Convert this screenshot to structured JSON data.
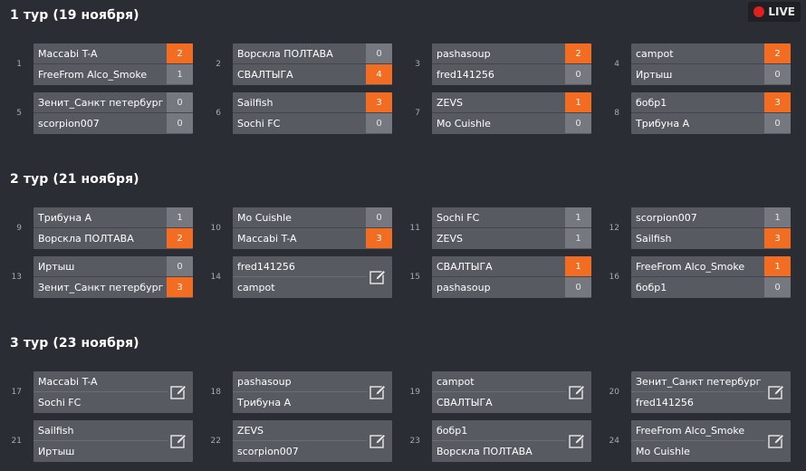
{
  "live": {
    "label": "LIVE"
  },
  "colors": {
    "background": "#2b2d35",
    "card": "#585a62",
    "score": "#767880",
    "win": "#f26d21",
    "live_dot": "#e0201c"
  },
  "rounds": [
    {
      "title": "1 тур (19 ноября)",
      "matches": [
        {
          "num": "1",
          "home": "Maccabi T-A",
          "away": "FreeFrom Alco_Smoke",
          "home_score": "2",
          "away_score": "1",
          "winner": "home"
        },
        {
          "num": "2",
          "home": "Ворскла ПОЛТАВА",
          "away": "СВАЛТЫГА",
          "home_score": "0",
          "away_score": "4",
          "winner": "away"
        },
        {
          "num": "3",
          "home": "pashasoup",
          "away": "fred141256",
          "home_score": "2",
          "away_score": "0",
          "winner": "home"
        },
        {
          "num": "4",
          "home": "campot",
          "away": "Иртыш",
          "home_score": "2",
          "away_score": "0",
          "winner": "home"
        },
        {
          "num": "5",
          "home": "Зенит_Санкт петербург",
          "away": "scorpion007",
          "home_score": "0",
          "away_score": "0",
          "winner": ""
        },
        {
          "num": "6",
          "home": "Sailfish",
          "away": "Sochi FC",
          "home_score": "3",
          "away_score": "0",
          "winner": "home"
        },
        {
          "num": "7",
          "home": "ZEVS",
          "away": "Mo Cuishle",
          "home_score": "1",
          "away_score": "0",
          "winner": "home"
        },
        {
          "num": "8",
          "home": "бобр1",
          "away": "Трибуна А",
          "home_score": "3",
          "away_score": "0",
          "winner": "home"
        }
      ]
    },
    {
      "title": "2 тур (21 ноября)",
      "matches": [
        {
          "num": "9",
          "home": "Трибуна А",
          "away": "Ворскла ПОЛТАВА",
          "home_score": "1",
          "away_score": "2",
          "winner": "away"
        },
        {
          "num": "10",
          "home": "Mo Cuishle",
          "away": "Maccabi T-A",
          "home_score": "0",
          "away_score": "3",
          "winner": "away"
        },
        {
          "num": "11",
          "home": "Sochi FC",
          "away": "ZEVS",
          "home_score": "1",
          "away_score": "1",
          "winner": ""
        },
        {
          "num": "12",
          "home": "scorpion007",
          "away": "Sailfish",
          "home_score": "1",
          "away_score": "3",
          "winner": "away"
        },
        {
          "num": "13",
          "home": "Иртыш",
          "away": "Зенит_Санкт петербург",
          "home_score": "0",
          "away_score": "3",
          "winner": "away"
        },
        {
          "num": "14",
          "home": "fred141256",
          "away": "campot",
          "home_score": "",
          "away_score": "",
          "winner": "",
          "pending": true
        },
        {
          "num": "15",
          "home": "СВАЛТЫГА",
          "away": "pashasoup",
          "home_score": "1",
          "away_score": "0",
          "winner": "home"
        },
        {
          "num": "16",
          "home": "FreeFrom Alco_Smoke",
          "away": "бобр1",
          "home_score": "1",
          "away_score": "0",
          "winner": "home"
        }
      ]
    },
    {
      "title": "3 тур (23 ноября)",
      "matches": [
        {
          "num": "17",
          "home": "Maccabi T-A",
          "away": "Sochi FC",
          "home_score": "",
          "away_score": "",
          "winner": "",
          "pending": true
        },
        {
          "num": "18",
          "home": "pashasoup",
          "away": "Трибуна А",
          "home_score": "",
          "away_score": "",
          "winner": "",
          "pending": true
        },
        {
          "num": "19",
          "home": "campot",
          "away": "СВАЛТЫГА",
          "home_score": "",
          "away_score": "",
          "winner": "",
          "pending": true
        },
        {
          "num": "20",
          "home": "Зенит_Санкт петербург",
          "away": "fred141256",
          "home_score": "",
          "away_score": "",
          "winner": "",
          "pending": true
        },
        {
          "num": "21",
          "home": "Sailfish",
          "away": "Иртыш",
          "home_score": "",
          "away_score": "",
          "winner": "",
          "pending": true
        },
        {
          "num": "22",
          "home": "ZEVS",
          "away": "scorpion007",
          "home_score": "",
          "away_score": "",
          "winner": "",
          "pending": true
        },
        {
          "num": "23",
          "home": "бобр1",
          "away": "Ворскла ПОЛТАВА",
          "home_score": "",
          "away_score": "",
          "winner": "",
          "pending": true
        },
        {
          "num": "24",
          "home": "FreeFrom Alco_Smoke",
          "away": "Mo Cuishle",
          "home_score": "",
          "away_score": "",
          "winner": "",
          "pending": true
        }
      ]
    }
  ],
  "icons": {
    "edit": "edit-icon",
    "live": "live-dot-icon"
  }
}
